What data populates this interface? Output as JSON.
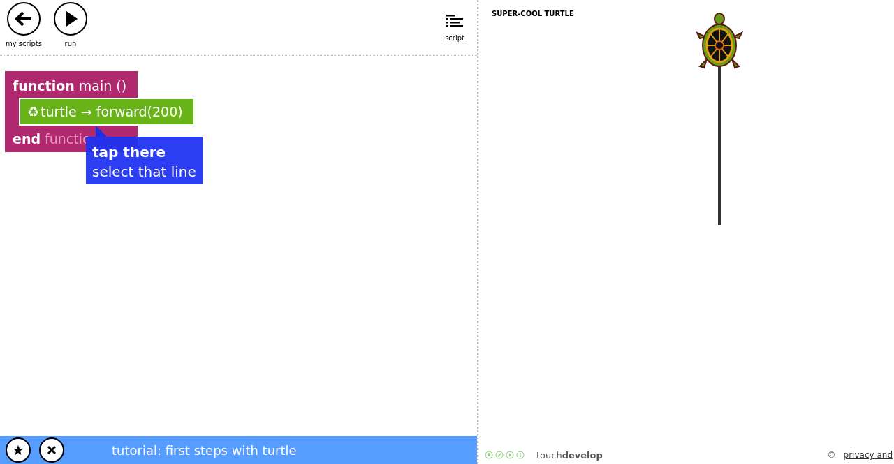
{
  "toolbar": {
    "buttons": [
      {
        "kind": "back",
        "label": "my scripts"
      },
      {
        "kind": "run",
        "label": "run"
      }
    ],
    "script_button": {
      "label": "script"
    }
  },
  "code": {
    "header": {
      "keyword": "function",
      "rest": "main ()"
    },
    "statement": {
      "icon": "♻",
      "text": "turtle → forward(200)"
    },
    "footer": {
      "keyword": "end",
      "rest": "functio"
    }
  },
  "tooltip": {
    "title": "tap there",
    "text": "select that line"
  },
  "tutorial_bar": {
    "buttons": [
      {
        "kind": "star"
      },
      {
        "kind": "close"
      }
    ],
    "text": "tutorial: first steps with turtle"
  },
  "output": {
    "title": "SUPER-COOL TURTLE"
  },
  "footer": {
    "icons": [
      {
        "kind": "bulb"
      },
      {
        "kind": "edit"
      },
      {
        "kind": "play"
      },
      {
        "kind": "info"
      }
    ],
    "logo": "touch**develop**",
    "copyright": "©",
    "link": "privacy and"
  }
}
